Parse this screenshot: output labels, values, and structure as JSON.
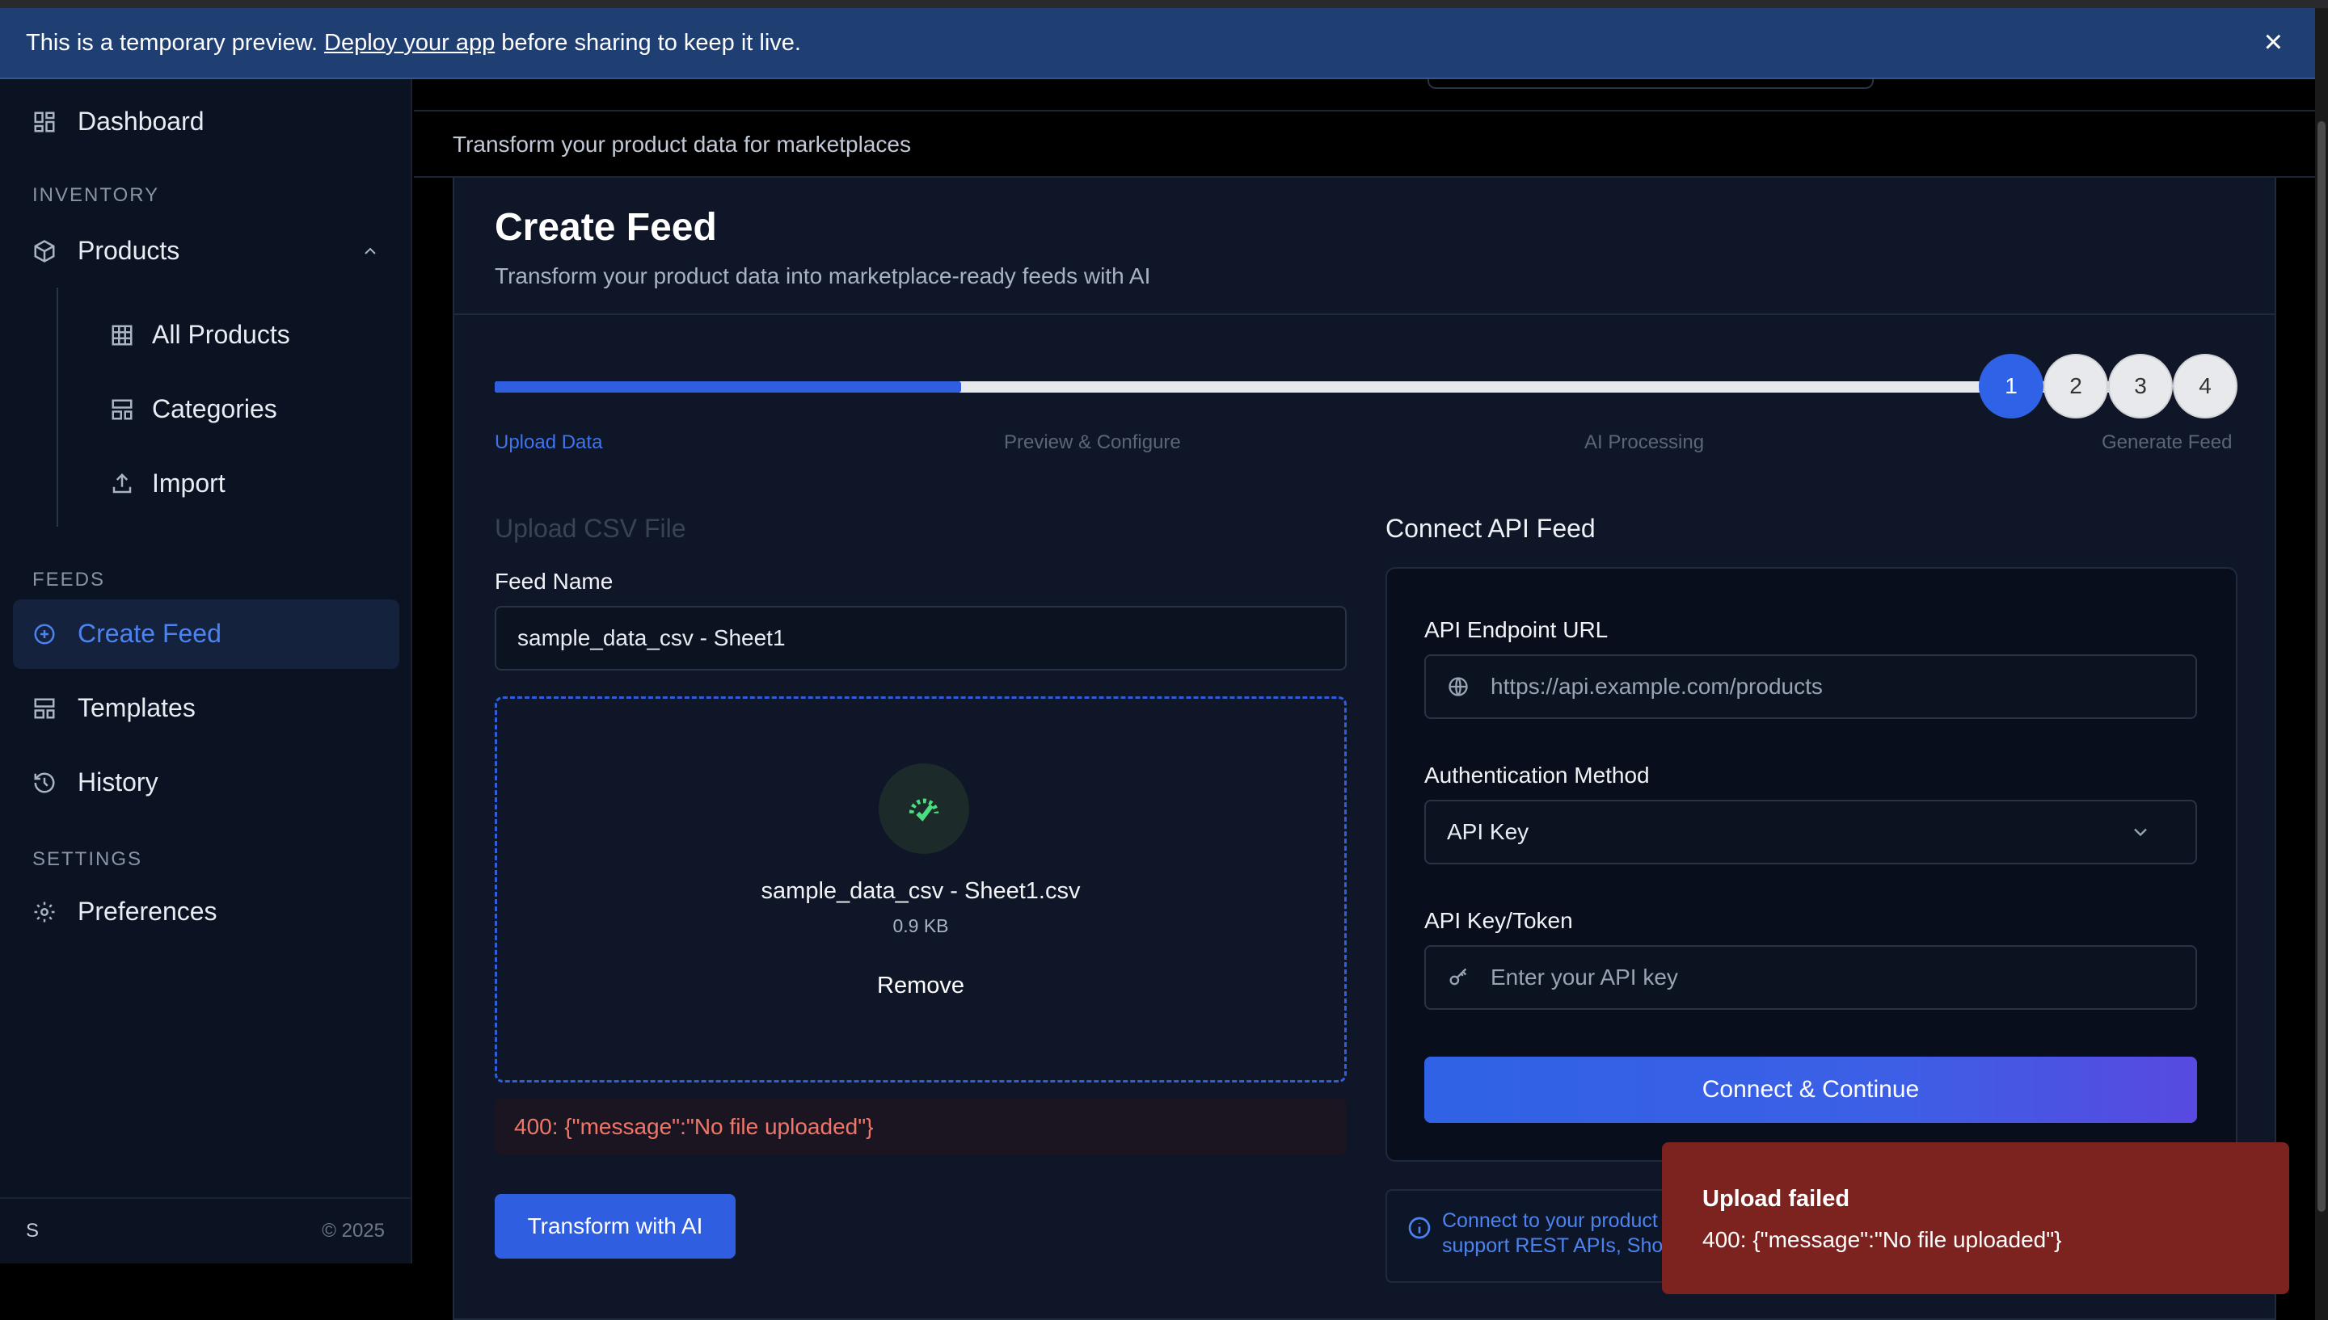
{
  "banner": {
    "text_before": "This is a temporary preview.",
    "link": "Deploy your app",
    "text_after": "before sharing to keep it live.",
    "close": "×"
  },
  "sidebar": {
    "dashboard": "Dashboard",
    "inventory_label": "INVENTORY",
    "products": "Products",
    "all_products": "All Products",
    "categories": "Categories",
    "import": "Import",
    "feeds_label": "FEEDS",
    "create_feed": "Create Feed",
    "templates": "Templates",
    "history": "History",
    "settings_label": "SETTINGS",
    "preferences": "Preferences",
    "user_initial": "S",
    "copyright": "© 2025"
  },
  "page": {
    "subtitle": "Transform your product data for marketplaces",
    "title": "Create Feed",
    "description": "Transform your product data into marketplace-ready feeds with AI"
  },
  "steps": {
    "progress_percent": 28.3,
    "items": [
      {
        "number": "1",
        "label": "Upload Data"
      },
      {
        "number": "2",
        "label": "Preview & Configure"
      },
      {
        "number": "3",
        "label": "AI Processing"
      },
      {
        "number": "4",
        "label": "Generate Feed"
      }
    ]
  },
  "upload": {
    "heading": "Upload CSV File",
    "feed_name_label": "Feed Name",
    "feed_name_value": "sample_data_csv - Sheet1",
    "file_name": "sample_data_csv - Sheet1.csv",
    "file_size": "0.9 KB",
    "remove": "Remove",
    "error": "400: {\"message\":\"No file uploaded\"}",
    "transform_button": "Transform with AI"
  },
  "api": {
    "heading": "Connect API Feed",
    "endpoint_label": "API Endpoint URL",
    "endpoint_placeholder": "https://api.example.com/products",
    "auth_label": "Authentication Method",
    "auth_value": "API Key",
    "key_label": "API Key/Token",
    "key_placeholder": "Enter your API key",
    "connect_button": "Connect & Continue",
    "info_line1": "Connect to your product",
    "info_line2": "support REST APIs, Shop"
  },
  "toast": {
    "title": "Upload failed",
    "message": "400: {\"message\":\"No file uploaded\"}"
  },
  "colors": {
    "accent": "#2f62e6",
    "toast_bg": "#7c231f",
    "success_icon": "#4ade80"
  }
}
